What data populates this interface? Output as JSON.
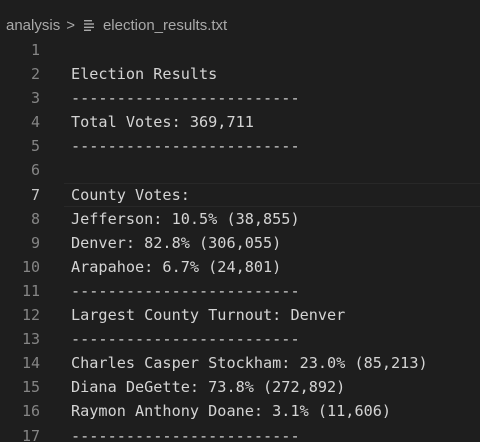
{
  "breadcrumb": {
    "folder": "analysis",
    "separator": ">",
    "file_icon": "lines-file-icon",
    "file": "election_results.txt"
  },
  "editor": {
    "current_line": 7,
    "lines": [
      {
        "num": "1",
        "text": ""
      },
      {
        "num": "2",
        "text": "Election Results"
      },
      {
        "num": "3",
        "text": "-------------------------"
      },
      {
        "num": "4",
        "text": "Total Votes: 369,711"
      },
      {
        "num": "5",
        "text": "-------------------------"
      },
      {
        "num": "6",
        "text": ""
      },
      {
        "num": "7",
        "text": "County Votes:"
      },
      {
        "num": "8",
        "text": "Jefferson: 10.5% (38,855)"
      },
      {
        "num": "9",
        "text": "Denver: 82.8% (306,055)"
      },
      {
        "num": "10",
        "text": "Arapahoe: 6.7% (24,801)"
      },
      {
        "num": "11",
        "text": "-------------------------"
      },
      {
        "num": "12",
        "text": "Largest County Turnout: Denver"
      },
      {
        "num": "13",
        "text": "-------------------------"
      },
      {
        "num": "14",
        "text": "Charles Casper Stockham: 23.0% (85,213)"
      },
      {
        "num": "15",
        "text": "Diana DeGette: 73.8% (272,892)"
      },
      {
        "num": "16",
        "text": "Raymon Anthony Doane: 3.1% (11,606)"
      },
      {
        "num": "17",
        "text": "-------------------------"
      }
    ]
  },
  "colors": {
    "background": "#1e1e1e",
    "text": "#d4d4d4",
    "line_number": "#858585",
    "line_number_active": "#c6c6c6",
    "breadcrumb": "#a9a9a9"
  }
}
